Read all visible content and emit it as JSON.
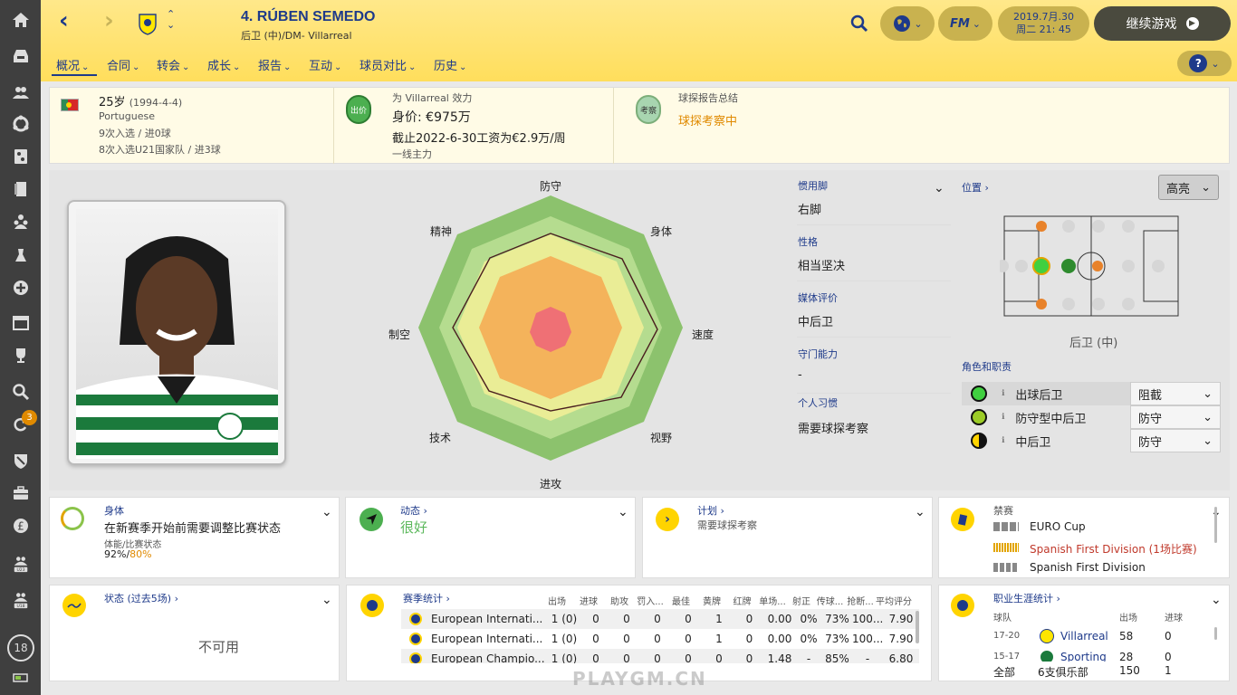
{
  "header": {
    "player_name": "4. RÚBEN SEMEDO",
    "position_club": "后卫 (中)/DM- Villarreal",
    "date": "2019.7月.30",
    "weekday_time": "周二 21: 45",
    "continue_label": "继续游戏",
    "fm_label": "FM"
  },
  "tabs": [
    "概况",
    "合同",
    "转会",
    "成长",
    "报告",
    "互动",
    "球员对比",
    "历史"
  ],
  "info": {
    "age": "25岁",
    "birth": "(1994-4-4)",
    "nationality": "Portuguese",
    "caps": "9次入选 / 进0球",
    "u21": "8次入选U21国家队 / 进3球",
    "club_title": "为 Villarreal 效力",
    "value": "身价: €975万",
    "wage": "截止2022-6-30工资为€2.9万/周",
    "squad_status": "一线主力",
    "badge_price": "出价",
    "scout_title": "球探报告总结",
    "scout_status": "球探考察中",
    "badge_scout": "考察"
  },
  "radar": {
    "top": "防守",
    "top_right": "身体",
    "right": "速度",
    "bottom_right": "视野",
    "bottom": "进攻",
    "bottom_left": "技术",
    "left": "制空",
    "top_left": "精神"
  },
  "attributes": {
    "foot_label": "惯用脚",
    "foot_value": "右脚",
    "personality_label": "性格",
    "personality_value": "相当坚决",
    "media_label": "媒体评价",
    "media_value": "中后卫",
    "gk_label": "守门能力",
    "gk_value": "-",
    "habits_label": "个人习惯",
    "habits_value": "需要球探考察"
  },
  "position": {
    "label": "位置",
    "highlight_label": "高亮",
    "pos_name": "后卫 (中)",
    "roles_label": "角色和职责",
    "roles": [
      {
        "name": "出球后卫",
        "duty": "阻截"
      },
      {
        "name": "防守型中后卫",
        "duty": "防守"
      },
      {
        "name": "中后卫",
        "duty": "防守"
      }
    ]
  },
  "fitness": {
    "label": "身体",
    "text": "在新赛季开始前需要调整比赛状态",
    "sub": "体能/比赛状态",
    "cond": "92%",
    "sep": "/",
    "sharp": "80%"
  },
  "morale": {
    "label": "动态",
    "value": "很好"
  },
  "plan": {
    "label": "计划",
    "text": "需要球探考察"
  },
  "bans": {
    "label": "禁赛",
    "items": [
      {
        "text": "EURO Cup",
        "color": "#222222"
      },
      {
        "text": "Spanish First Division (1场比赛)",
        "color": "#c0392b"
      },
      {
        "text": "Spanish First Division",
        "color": "#222222"
      }
    ]
  },
  "form": {
    "label": "状态 (过去5场)",
    "value": "不可用"
  },
  "season": {
    "label": "赛季统计",
    "headers": [
      "出场",
      "进球",
      "助攻",
      "罚入...",
      "最佳",
      "黄牌",
      "红牌",
      "单场...",
      "射正",
      "传球...",
      "抢断...",
      "平均评分"
    ],
    "rows": [
      {
        "comp": "European Internati...",
        "vals": [
          "1 (0)",
          "0",
          "0",
          "0",
          "0",
          "1",
          "0",
          "0.00",
          "0%",
          "73%",
          "100...",
          "7.90"
        ]
      },
      {
        "comp": "European Internati...",
        "vals": [
          "1 (0)",
          "0",
          "0",
          "0",
          "0",
          "1",
          "0",
          "0.00",
          "0%",
          "73%",
          "100...",
          "7.90"
        ]
      },
      {
        "comp": "European Champio...",
        "vals": [
          "1 (0)",
          "0",
          "0",
          "0",
          "0",
          "0",
          "0",
          "1.48",
          "-",
          "85%",
          "-",
          "6.80"
        ]
      }
    ]
  },
  "career": {
    "label": "职业生涯统计",
    "col_team": "球队",
    "col_apps": "出场",
    "col_goals": "进球",
    "rows": [
      {
        "season": "17-20",
        "team": "Villarreal",
        "apps": "58",
        "goals": "0"
      },
      {
        "season": "15-17",
        "team": "Sporting",
        "apps": "28",
        "goals": "0"
      }
    ],
    "total_label": "全部",
    "total_clubs": "6支俱乐部",
    "total_apps": "150",
    "total_goals": "1"
  },
  "sidebar_badges": {
    "notif": "3",
    "day": "18"
  },
  "watermark": "PLAYGM.CN"
}
